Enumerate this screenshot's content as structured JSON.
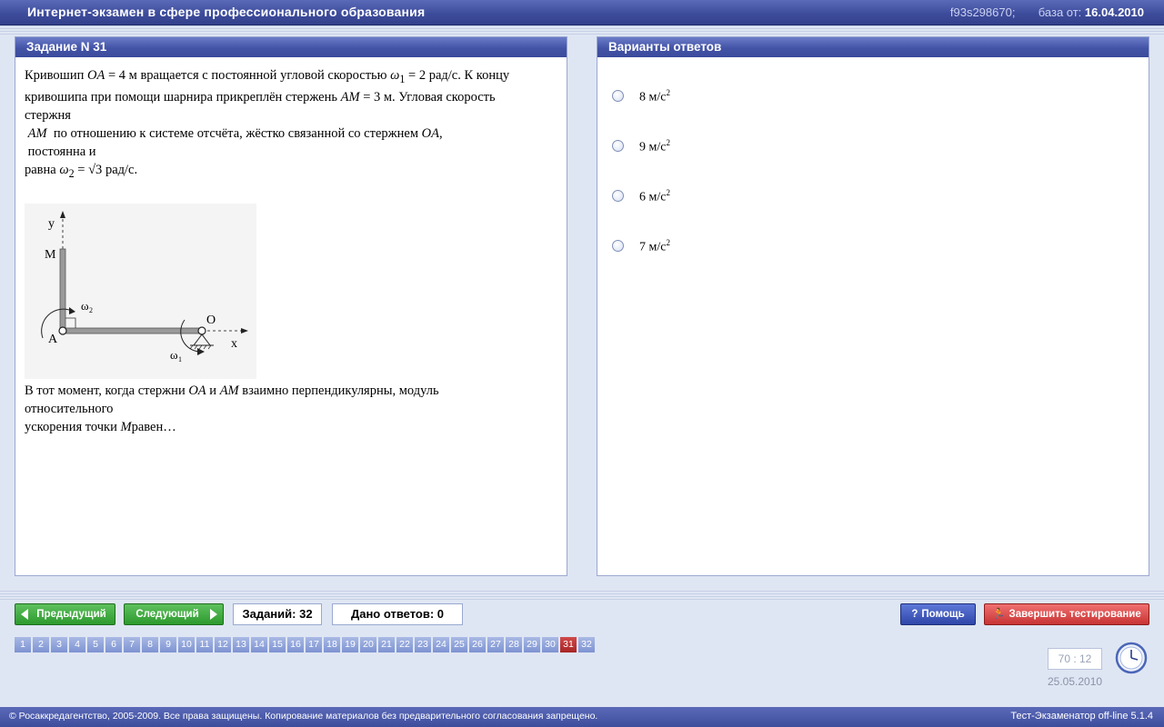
{
  "header": {
    "title": "Интернет-экзамен в сфере профессионального образования",
    "code": "f93s298670;",
    "db_label": "база от:",
    "db_date": "16.04.2010"
  },
  "task": {
    "heading": "Задание N 31",
    "p1_a": "Кривошип",
    "p1_OA": "OA",
    "p1_b": "= 4 м вращается с постоянной угловой скоростью",
    "p1_w1": "ω",
    "p1_w1_sub": "1",
    "p1_c": "= 2 рад/с. К концу",
    "p2_a": "кривошипа при помощи шарнира прикреплён стержень",
    "p2_AM": "AM",
    "p2_b": "= 3 м. Угловая скорость",
    "p3": "стержня",
    "p4_AM": "AM",
    "p4_a": "по отношению к системе отсчёта, жёстко связанной со стержнем",
    "p4_OA": "OA",
    "p4_b": ",",
    "p5": "постоянна и",
    "p6_a": "равна",
    "p6_w2": "ω",
    "p6_w2_sub": "2",
    "p6_eq": "=",
    "p6_root": "√3",
    "p6_b": "рад/с.",
    "q1_a": "В тот момент, когда стержни",
    "q1_OA": "OA",
    "q1_and": "и",
    "q1_AM": "AM",
    "q1_b": "взаимно перпендикулярны, модуль",
    "q2": "относительного",
    "q3_a": "ускорения точки",
    "q3_M": "M",
    "q3_b": "равен…",
    "figure": {
      "y": "y",
      "x": "x",
      "M": "M",
      "A": "A",
      "O": "O",
      "w2": "ω",
      "w2_sub": "2",
      "w1": "ω",
      "w1_sub": "1"
    }
  },
  "answers": {
    "heading": "Варианты ответов",
    "options": [
      {
        "value": "8",
        "unit": "м/с",
        "exp": "2"
      },
      {
        "value": "9",
        "unit": "м/с",
        "exp": "2"
      },
      {
        "value": "6",
        "unit": "м/с",
        "exp": "2"
      },
      {
        "value": "7",
        "unit": "м/с",
        "exp": "2"
      }
    ]
  },
  "controls": {
    "prev": "Предыдущий",
    "next": "Следующий",
    "total_tasks": "Заданий: 32",
    "answered": "Дано ответов: 0",
    "help": "Помощь",
    "finish": "Завершить тестирование"
  },
  "pages": [
    "1",
    "2",
    "3",
    "4",
    "5",
    "6",
    "7",
    "8",
    "9",
    "10",
    "11",
    "12",
    "13",
    "14",
    "15",
    "16",
    "17",
    "18",
    "19",
    "20",
    "21",
    "22",
    "23",
    "24",
    "25",
    "26",
    "27",
    "28",
    "29",
    "30",
    "31",
    "32"
  ],
  "current_page": "31",
  "timer": "70 : 12",
  "date": "25.05.2010",
  "footer": {
    "copyright": "© Росаккредагентство, 2005-2009. Все права защищены. Копирование материалов без предварительного согласования запрещено.",
    "version": "Тест-Экзаменатор off-line 5.1.4"
  }
}
